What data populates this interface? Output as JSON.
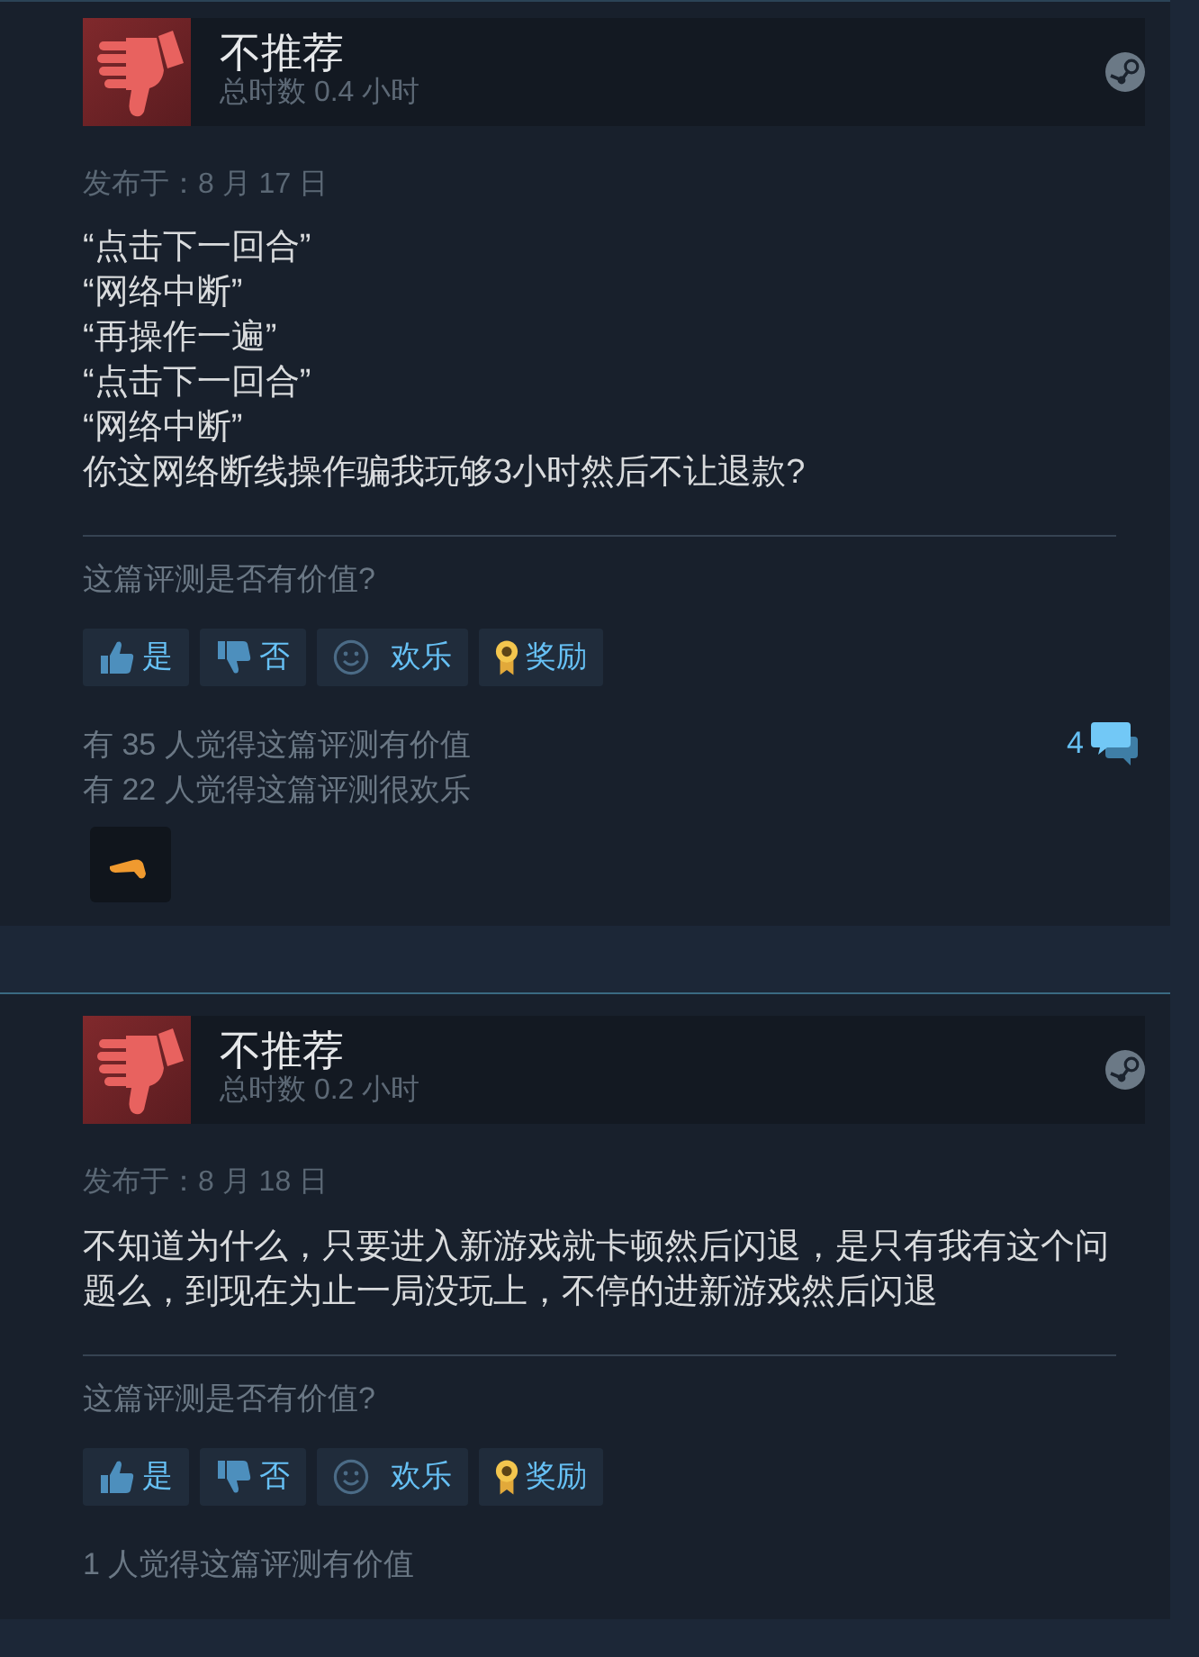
{
  "reviews": [
    {
      "verdict": {
        "kind": "not_recommended",
        "label": "不推荐"
      },
      "playtime": "总时数 0.4 小时",
      "posted": "发布于：8 月 17 日",
      "text": "“点击下一回合”\n“网络中断”\n“再操作一遍”\n“点击下一回合”\n“网络中断”\n你这网络断线操作骗我玩够3小时然后不让退款?",
      "helpful_prompt": "这篇评测是否有价值?",
      "buttons": [
        {
          "kind": "yes",
          "label": "是"
        },
        {
          "kind": "no",
          "label": "否"
        },
        {
          "kind": "funny",
          "label": "欢乐"
        },
        {
          "kind": "award",
          "label": "奖励"
        }
      ],
      "stats": [
        "有 35 人觉得这篇评测有价值",
        "有 22 人觉得这篇评测很欢乐"
      ],
      "comments": "4",
      "has_award": true
    },
    {
      "verdict": {
        "kind": "not_recommended",
        "label": "不推荐"
      },
      "playtime": "总时数 0.2 小时",
      "posted": "发布于：8 月 18 日",
      "text": "不知道为什么，只要进入新游戏就卡顿然后闪退，是只有我有这个问题么，到现在为止一局没玩上，不停的进新游戏然后闪退",
      "helpful_prompt": "这篇评测是否有价值?",
      "buttons": [
        {
          "kind": "yes",
          "label": "是"
        },
        {
          "kind": "no",
          "label": "否"
        },
        {
          "kind": "funny",
          "label": "欢乐"
        },
        {
          "kind": "award",
          "label": "奖励"
        }
      ],
      "stats": [
        "1 人觉得这篇评测有价值"
      ],
      "has_award": false
    }
  ]
}
